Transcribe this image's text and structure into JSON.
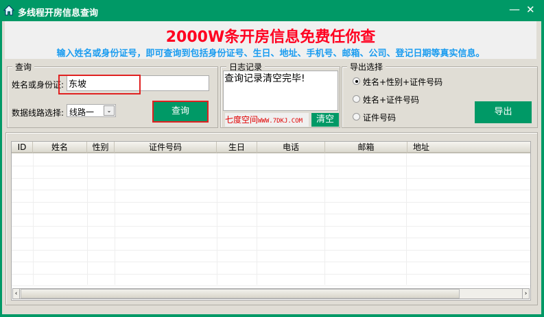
{
  "window": {
    "title": "多线程开房信息查询",
    "minimize": "—",
    "close": "✕"
  },
  "banner": {
    "headline": "2000W条开房信息免费任你查",
    "subtitle": "输入姓名或身份证号，即可查询到包括身份证号、生日、地址、手机号、邮箱、公司、登记日期等真实信息。",
    "headline_color": "#ff0020",
    "subtitle_color": "#1a9cf0"
  },
  "query": {
    "group_label": "查询",
    "name_label": "姓名或身份证:",
    "name_value": "东坡",
    "line_label": "数据线路选择:",
    "line_value": "线路一",
    "search_button": "查询"
  },
  "log": {
    "group_label": "日志记录",
    "text": "查询记录清空完毕!",
    "site_name": "七度空间",
    "site_url": "WWW.7DKJ.COM",
    "clear_button": "清空"
  },
  "export": {
    "group_label": "导出选择",
    "options": [
      {
        "label": "姓名+性别+证件号码",
        "checked": true
      },
      {
        "label": "姓名+证件号码",
        "checked": false
      },
      {
        "label": "证件号码",
        "checked": false
      }
    ],
    "export_button": "导出"
  },
  "table": {
    "columns": [
      "ID",
      "姓名",
      "性别",
      "证件号码",
      "生日",
      "电话",
      "邮箱",
      "地址"
    ],
    "rows": []
  },
  "accent": "#009966"
}
